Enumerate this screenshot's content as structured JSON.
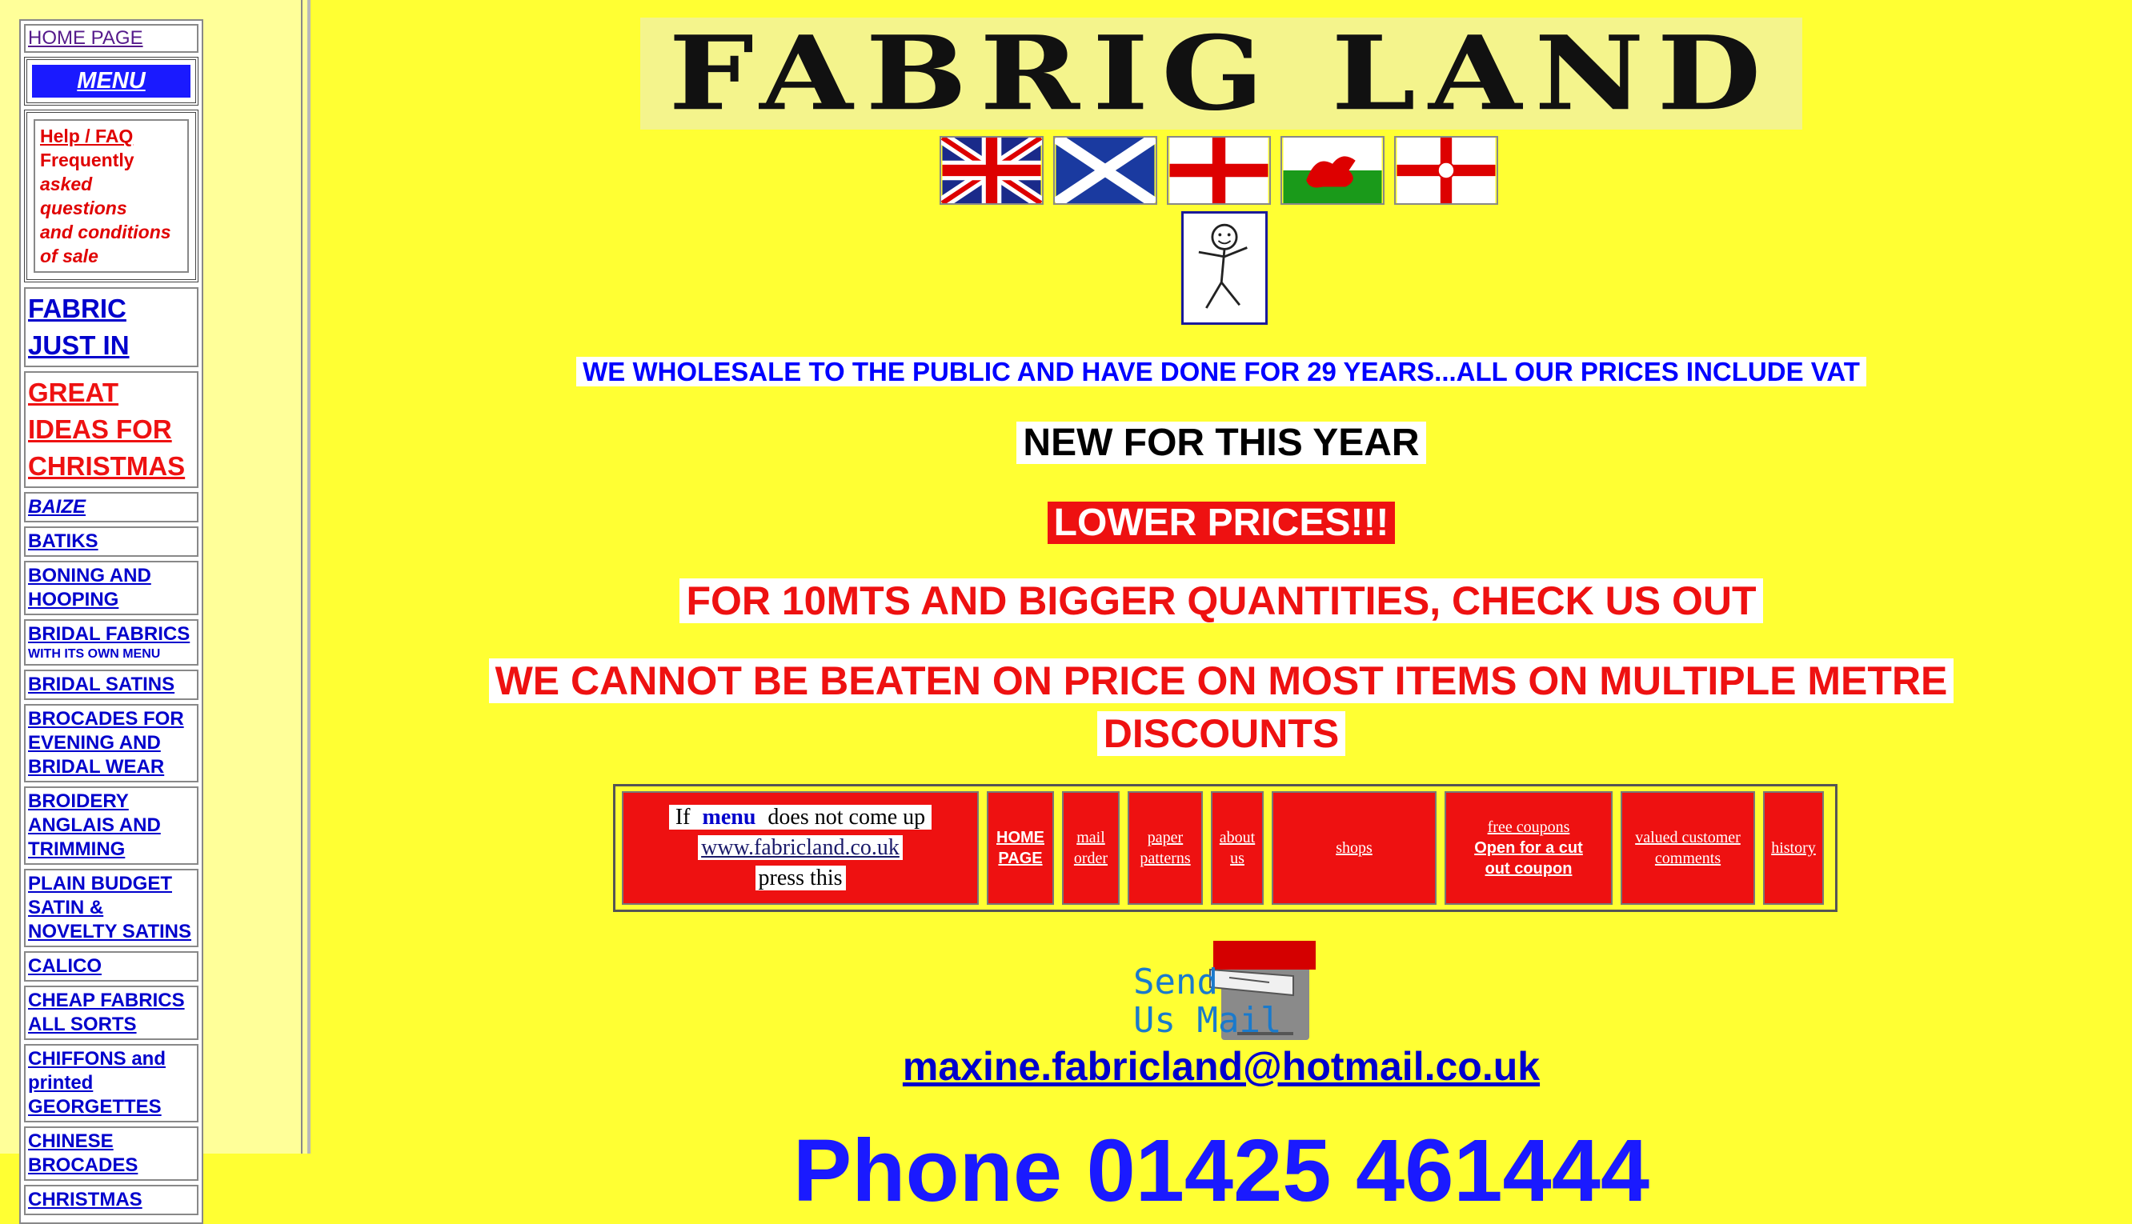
{
  "sidebar": {
    "home": "HOME PAGE",
    "menu": "MENU",
    "faq_title": "Help / FAQ",
    "faq_line1": "Frequently",
    "faq_line2": "asked  questions",
    "faq_line3": "and conditions",
    "faq_line4": "of sale",
    "fabric_line1": "FABRIC",
    "fabric_line2": "JUST IN",
    "great_line1": "GREAT",
    "great_line2": "IDEAS FOR",
    "great_line3": "CHRISTMAS",
    "items": [
      {
        "label": "BAIZE"
      },
      {
        "label": "BATIKS"
      },
      {
        "label": "BONING AND HOOPING"
      },
      {
        "label": "BRIDAL FABRICS",
        "sub": "WITH ITS OWN MENU"
      },
      {
        "label": "BRIDAL SATINS"
      },
      {
        "label": "BROCADES FOR EVENING AND BRIDAL WEAR"
      },
      {
        "label": "BROIDERY ANGLAIS AND TRIMMING"
      },
      {
        "label": "PLAIN BUDGET SATIN & NOVELTY SATINS"
      },
      {
        "label": "CALICO"
      },
      {
        "label": "CHEAP FABRICS ALL SORTS"
      },
      {
        "label": "CHIFFONS and printed GEORGETTES"
      },
      {
        "label": "CHINESE BROCADES"
      },
      {
        "label": "CHRISTMAS"
      }
    ]
  },
  "header": {
    "logo": "FABRIG LAND"
  },
  "flags": [
    "union-jack",
    "scotland",
    "england",
    "wales",
    "northern-ireland"
  ],
  "main": {
    "wholesale": "WE WHOLESALE TO THE PUBLIC AND HAVE DONE FOR 29 YEARS...ALL OUR PRICES INCLUDE VAT",
    "new_year": "NEW FOR THIS YEAR",
    "lower_prices": " LOWER PRICES!!!",
    "quantities": " FOR 10MTS AND BIGGER QUANTITIES, CHECK US OUT",
    "cannot_beat_1": " WE CANNOT BE BEATEN ON PRICE ON MOST ITEMS ON MULTIPLE METRE",
    "cannot_beat_2": "DISCOUNTS"
  },
  "nav": {
    "if_text": "If ",
    "menu_word": "menu",
    "not_come": " does not come up",
    "url": "www.fabricland.co.uk",
    "press": "press this",
    "home_page_1": "HOME",
    "home_page_2": "PAGE",
    "mail_order_1": "mail",
    "mail_order_2": "order",
    "paper_patterns_1": "paper",
    "paper_patterns_2": "patterns",
    "about_us_1": "about",
    "about_us_2": "us",
    "shops": "shops",
    "coupons_1": "free coupons",
    "coupons_2": "Open for a cut",
    "coupons_3": "out coupon",
    "comments_1": "valued customer",
    "comments_2": "comments",
    "history": "history"
  },
  "contact": {
    "mail_line1": "Send",
    "mail_line2": "Us Mail",
    "email": "maxine.fabricland@hotmail.co.uk",
    "phone": "Phone    01425 461444"
  },
  "colors": {
    "background": "#ffff33",
    "sidebar": "#ffff99",
    "accent_red": "#ee1111",
    "accent_blue": "#0000cc"
  }
}
